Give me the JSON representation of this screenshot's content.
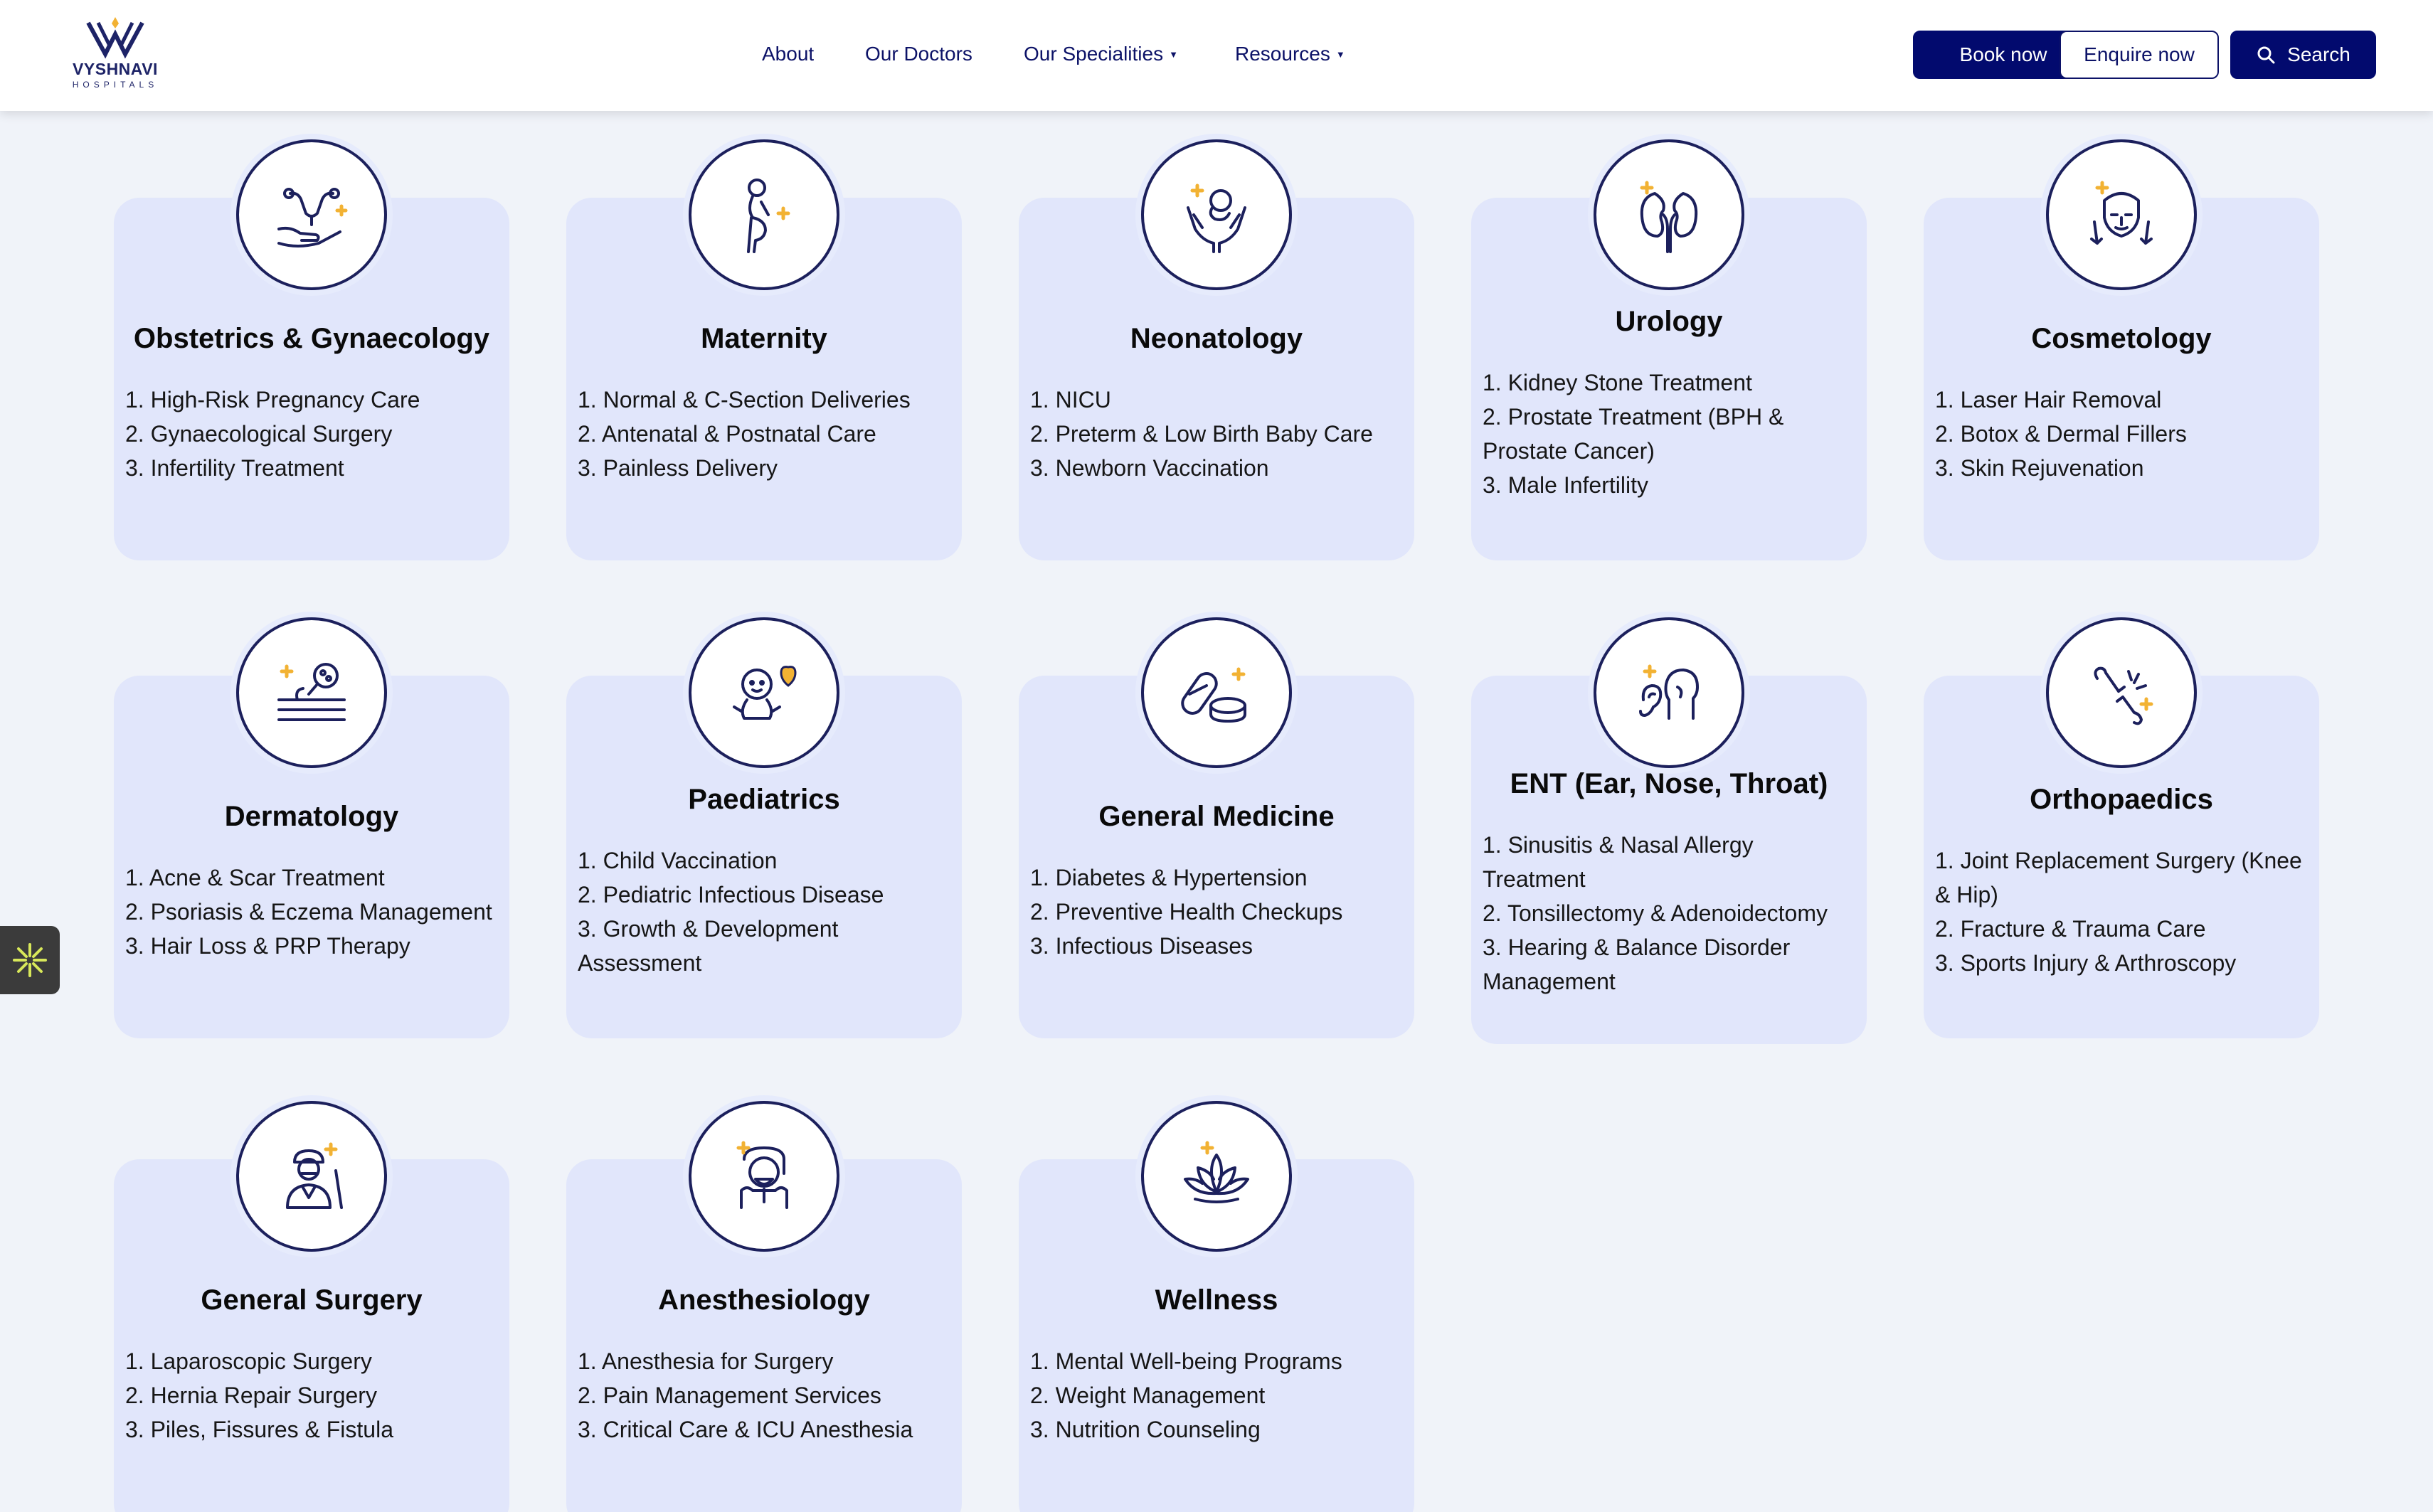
{
  "logo": {
    "name": "VYSHNAVI",
    "tagline": "HOSPITALS"
  },
  "nav": {
    "about": "About",
    "doctors": "Our Doctors",
    "specialities": "Our Specialities",
    "resources": "Resources"
  },
  "actions": {
    "book": "Book now",
    "enquire": "Enquire now",
    "search": "Search"
  },
  "colors": {
    "navy": "#020a6e",
    "card_bg": "#e1e6fb",
    "accent": "#f2b233",
    "page_bg": "#f0f3f9"
  },
  "specialities": [
    {
      "title": "Obstetrics & Gynaecology",
      "icon": "uterus-hand-icon",
      "items": [
        "1. High-Risk Pregnancy Care",
        "2. Gynaecological Surgery",
        "3. Infertility Treatment"
      ]
    },
    {
      "title": "Maternity",
      "icon": "pregnant-woman-icon",
      "items": [
        "1. Normal & C-Section Deliveries",
        "2. Antenatal & Postnatal Care",
        "3. Painless Delivery"
      ]
    },
    {
      "title": "Neonatology",
      "icon": "baby-in-hands-icon",
      "items": [
        "1. NICU",
        "2. Preterm & Low Birth Baby Care",
        "3. Newborn Vaccination"
      ]
    },
    {
      "title": "Urology",
      "icon": "kidney-icon",
      "items": [
        "1. Kidney Stone Treatment",
        "2. Prostate Treatment (BPH & Prostate Cancer)",
        "3. Male Infertility"
      ]
    },
    {
      "title": "Cosmetology",
      "icon": "face-care-icon",
      "items": [
        "1. Laser Hair Removal",
        "2. Botox & Dermal Fillers",
        "3. Skin Rejuvenation"
      ]
    },
    {
      "title": "Dermatology",
      "icon": "skin-magnifier-icon",
      "items": [
        "1. Acne & Scar Treatment",
        "2. Psoriasis & Eczema Management",
        "3. Hair Loss & PRP Therapy"
      ]
    },
    {
      "title": "Paediatrics",
      "icon": "child-heart-icon",
      "items": [
        "1. Child Vaccination",
        "2. Pediatric Infectious Disease",
        "3. Growth & Development Assessment"
      ]
    },
    {
      "title": "General Medicine",
      "icon": "pills-icon",
      "items": [
        "1. Diabetes & Hypertension",
        "2. Preventive Health Checkups",
        "3. Infectious Diseases"
      ]
    },
    {
      "title": "ENT (Ear, Nose, Throat)",
      "icon": "ear-head-icon",
      "items": [
        "1. Sinusitis & Nasal Allergy Treatment",
        "2. Tonsillectomy & Adenoidectomy",
        "3. Hearing & Balance Disorder Management"
      ]
    },
    {
      "title": "Orthopaedics",
      "icon": "bone-fracture-icon",
      "items": [
        "1. Joint Replacement Surgery (Knee & Hip)",
        "2. Fracture & Trauma Care",
        "3. Sports Injury & Arthroscopy"
      ]
    },
    {
      "title": "General Surgery",
      "icon": "surgeon-icon",
      "items": [
        "1. Laparoscopic Surgery",
        "2. Hernia Repair Surgery",
        "3. Piles, Fissures & Fistula"
      ]
    },
    {
      "title": "Anesthesiology",
      "icon": "anesthesia-mask-icon",
      "items": [
        "1. Anesthesia for Surgery",
        "2. Pain Management Services",
        "3. Critical Care & ICU Anesthesia"
      ]
    },
    {
      "title": "Wellness",
      "icon": "lotus-icon",
      "items": [
        "1. Mental Well-being Programs",
        "2. Weight Management",
        "3. Nutrition Counseling"
      ]
    }
  ]
}
